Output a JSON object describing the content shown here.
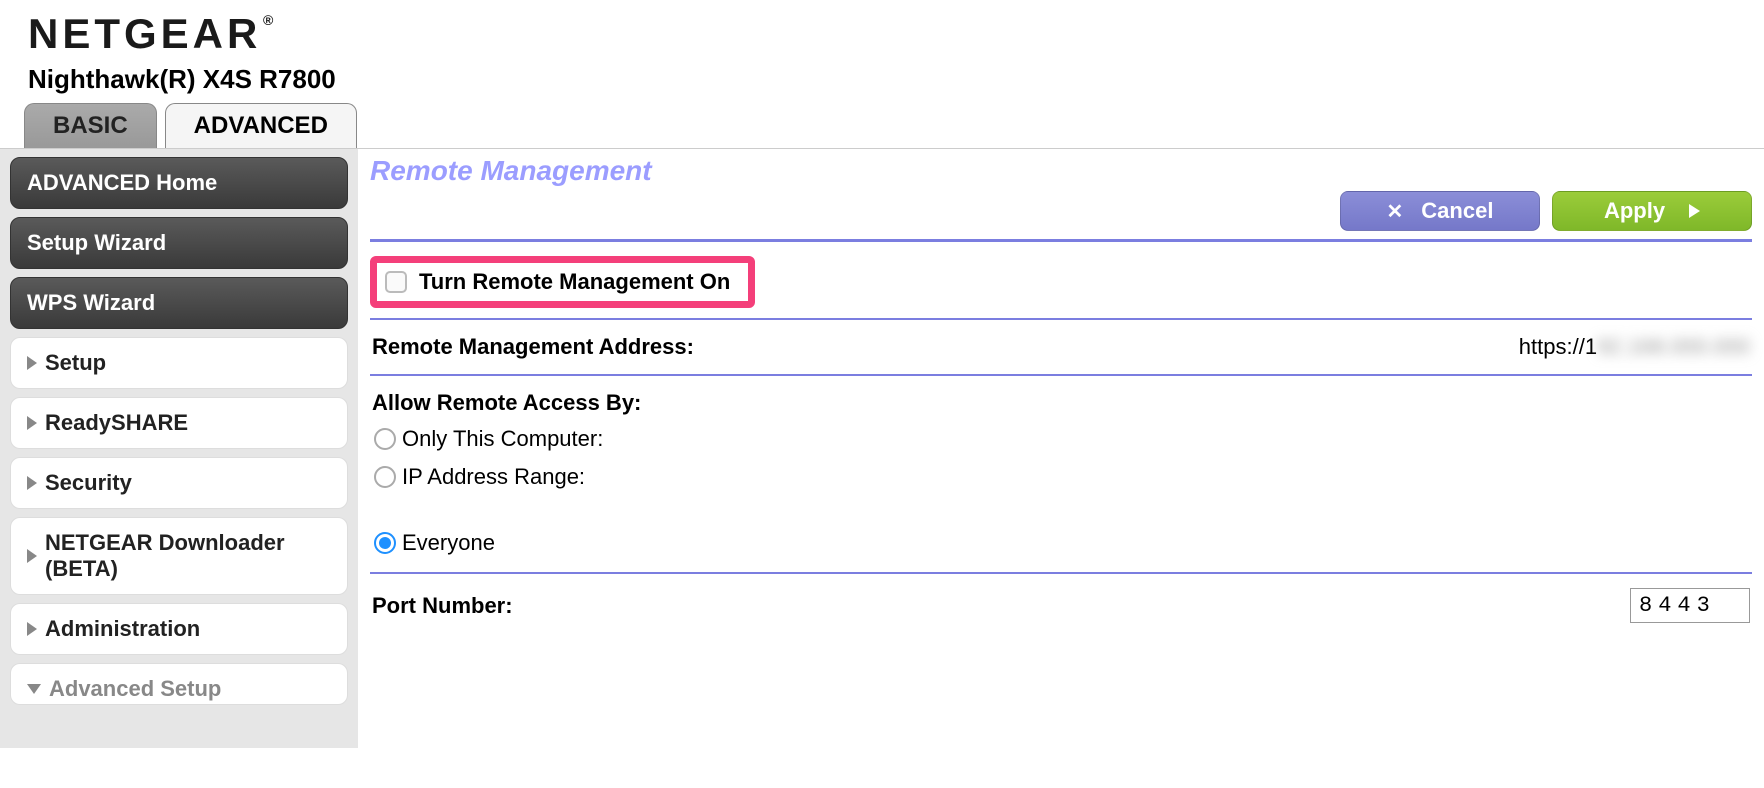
{
  "brand": "NETGEAR",
  "model": "Nighthawk(R) X4S R7800",
  "tabs": {
    "basic": "BASIC",
    "advanced": "ADVANCED"
  },
  "sidebar": {
    "home": "ADVANCED Home",
    "setup_wizard": "Setup Wizard",
    "wps_wizard": "WPS Wizard",
    "items": [
      {
        "label": "Setup"
      },
      {
        "label": "ReadySHARE"
      },
      {
        "label": "Security"
      },
      {
        "label": "NETGEAR Downloader (BETA)"
      },
      {
        "label": "Administration"
      },
      {
        "label": "Advanced Setup"
      }
    ]
  },
  "page": {
    "title": "Remote Management",
    "cancel": "Cancel",
    "apply": "Apply",
    "turn_on_label": "Turn Remote Management On",
    "turn_on_checked": false,
    "address_label": "Remote Management Address:",
    "address_value": "https://1",
    "allow_label": "Allow Remote Access By:",
    "radios": {
      "only_this": "Only This Computer:",
      "ip_range": "IP Address Range:",
      "everyone": "Everyone"
    },
    "selected_radio": "everyone",
    "port_label": "Port Number:",
    "port_value": "8443"
  }
}
